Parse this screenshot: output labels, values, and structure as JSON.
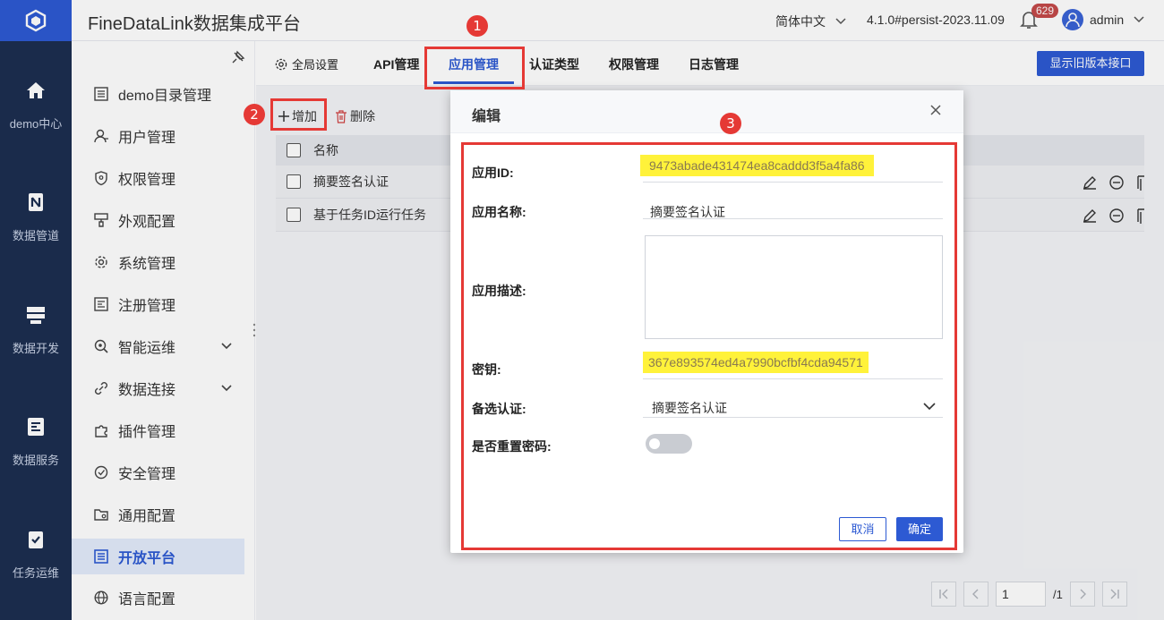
{
  "app": {
    "title": "FineDataLink数据集成平台"
  },
  "topbar": {
    "language": "简体中文",
    "version": "4.1.0#persist-2023.11.09",
    "notification_count": "629",
    "user": "admin"
  },
  "leftnav": [
    {
      "label": "demo中心",
      "icon": "home-icon"
    },
    {
      "label": "数据管道",
      "icon": "pipeline-icon"
    },
    {
      "label": "数据开发",
      "icon": "dev-icon"
    },
    {
      "label": "数据服务",
      "icon": "service-icon"
    },
    {
      "label": "任务运维",
      "icon": "task-icon"
    }
  ],
  "sidebar": {
    "items": [
      {
        "label": "demo目录管理",
        "icon": "list-icon"
      },
      {
        "label": "用户管理",
        "icon": "user-icon"
      },
      {
        "label": "权限管理",
        "icon": "shield-icon"
      },
      {
        "label": "外观配置",
        "icon": "brush-icon"
      },
      {
        "label": "系统管理",
        "icon": "gear-icon"
      },
      {
        "label": "注册管理",
        "icon": "register-icon"
      },
      {
        "label": "智能运维",
        "icon": "ops-icon"
      },
      {
        "label": "数据连接",
        "icon": "link-icon"
      },
      {
        "label": "插件管理",
        "icon": "plugin-icon"
      },
      {
        "label": "安全管理",
        "icon": "security-icon"
      },
      {
        "label": "通用配置",
        "icon": "folder-gear-icon"
      },
      {
        "label": "开放平台",
        "icon": "list-icon"
      },
      {
        "label": "语言配置",
        "icon": "globe-icon"
      }
    ]
  },
  "tabs": [
    {
      "label": "全局设置"
    },
    {
      "label": "API管理"
    },
    {
      "label": "应用管理"
    },
    {
      "label": "认证类型"
    },
    {
      "label": "权限管理"
    },
    {
      "label": "日志管理"
    }
  ],
  "toolbar": {
    "old_version_label": "显示旧版本接口",
    "add_label": "增加",
    "delete_label": "删除"
  },
  "table": {
    "header": "名称",
    "rows": [
      {
        "name": "摘要签名认证"
      },
      {
        "name": "基于任务ID运行任务"
      }
    ]
  },
  "pager": {
    "page": "1",
    "total": "/1"
  },
  "modal": {
    "title": "编辑",
    "fields": {
      "app_id_label": "应用ID:",
      "app_id": "9473abade431474ea8caddd3f5a4fa86",
      "app_name_label": "应用名称:",
      "app_name": "摘要签名认证",
      "app_desc_label": "应用描述:",
      "secret_label": "密钥:",
      "secret": "367e893574ed4a7990bcfbf4cda94571",
      "auth_label": "备选认证:",
      "auth_value": "摘要签名认证",
      "reset_label": "是否重置密码:"
    },
    "cancel_label": "取消",
    "ok_label": "确定"
  },
  "annotations": {
    "n1": "1",
    "n2": "2",
    "n3": "3"
  },
  "colors": {
    "accent": "#2d5ad3",
    "nav_bg": "#1c2e50",
    "annotation_red": "#e53935",
    "highlight": "#fff23a"
  }
}
